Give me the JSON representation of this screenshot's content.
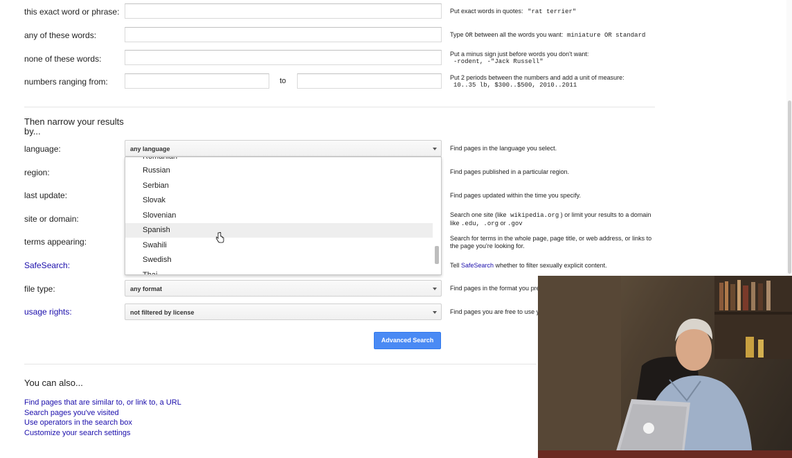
{
  "rows": [
    {
      "label": "this exact word or phrase:",
      "hint_text": "Put exact words in quotes:",
      "hint_code": "\"rat terrier\""
    },
    {
      "label": "any of these words:",
      "hint_text": "Type",
      "hint_code_or": "OR",
      "hint_text2": "between all the words you want:",
      "hint_code": "miniature OR standard"
    },
    {
      "label": "none of these words:",
      "hint_text": "Put a minus sign just before words you don't want:",
      "hint_code": "-rodent, -\"Jack Russell\""
    },
    {
      "label": "numbers ranging from:",
      "to": "to",
      "hint_text": "Put 2 periods between the numbers and add a unit of measure:",
      "hint_code": "10..35 lb, $300..$500, 2010..2011"
    }
  ],
  "narrow": {
    "title_line1": "Then narrow your results",
    "title_line2": "by...",
    "language": {
      "label": "language:",
      "value": "any language",
      "hint": "Find pages in the language you select."
    },
    "region": {
      "label": "region:",
      "hint": "Find pages published in a particular region."
    },
    "last_update": {
      "label": "last update:",
      "hint": "Find pages updated within the time you specify."
    },
    "site": {
      "label": "site or domain:",
      "hint_a": "Search one site (like",
      "hint_code1": "wikipedia.org",
      "hint_b": ") or limit your results to a domain",
      "hint_c": "like",
      "hint_code2": ".edu, .org",
      "hint_d": "or",
      "hint_code3": ".gov"
    },
    "terms": {
      "label": "terms appearing:",
      "hint_line1": "Search for terms in the whole page, page title, or web address, or links to",
      "hint_line2": "the page you're looking for."
    },
    "safesearch": {
      "label": "SafeSearch:",
      "hint_a": "Tell",
      "hint_link": "SafeSearch",
      "hint_b": "whether to filter sexually explicit content."
    },
    "file_type": {
      "label": "file type:",
      "value": "any format",
      "hint": "Find pages in the format you pre"
    },
    "usage_rights": {
      "label": "usage rights:",
      "value": "not filtered by license",
      "hint": "Find pages you are free to use y"
    }
  },
  "dropdown_options": [
    "Romanian",
    "Russian",
    "Serbian",
    "Slovak",
    "Slovenian",
    "Spanish",
    "Swahili",
    "Swedish",
    "Thai"
  ],
  "dropdown_highlighted": "Spanish",
  "advanced_search_button": "Advanced Search",
  "also": {
    "title": "You can also...",
    "links": [
      "Find pages that are similar to, or link to, a URL",
      "Search pages you've visited",
      "Use operators in the search box",
      "Customize your search settings"
    ]
  },
  "colors": {
    "link": "#1a0dab",
    "button": "#4a8af4"
  }
}
